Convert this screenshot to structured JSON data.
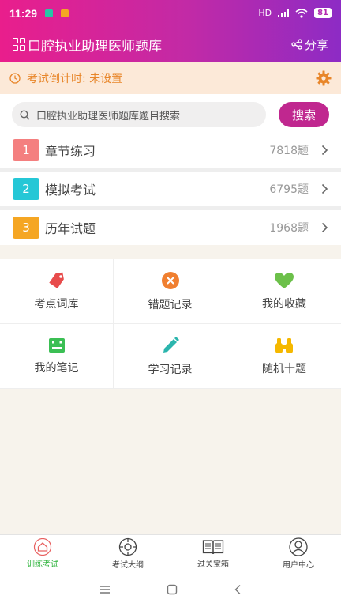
{
  "status": {
    "time": "11:29",
    "signal": "HD",
    "battery": "81"
  },
  "header": {
    "title": "口腔执业助理医师题库",
    "share_label": "分享"
  },
  "countdown": {
    "text": "考试倒计时: 未设置"
  },
  "search": {
    "placeholder": "口腔执业助理医师题库题目搜索",
    "button_label": "搜索"
  },
  "menu": [
    {
      "num": "1",
      "label": "章节练习",
      "count": "7818题",
      "color": "#f47f7f"
    },
    {
      "num": "2",
      "label": "模拟考试",
      "count": "6795题",
      "color": "#25c7d6"
    },
    {
      "num": "3",
      "label": "历年试题",
      "count": "1968题",
      "color": "#f5a623"
    }
  ],
  "tools": [
    {
      "label": "考点词库",
      "icon": "tag-icon",
      "color": "#e84c4c"
    },
    {
      "label": "错题记录",
      "icon": "close-circle-icon",
      "color": "#f07f30"
    },
    {
      "label": "我的收藏",
      "icon": "heart-icon",
      "color": "#6cc04a"
    },
    {
      "label": "我的笔记",
      "icon": "notebook-icon",
      "color": "#3bbf54"
    },
    {
      "label": "学习记录",
      "icon": "pencil-icon",
      "color": "#2bb5ad"
    },
    {
      "label": "随机十题",
      "icon": "binoculars-icon",
      "color": "#f5b800"
    }
  ],
  "tabs": [
    {
      "label": "训练考试",
      "icon": "home-icon",
      "active": true
    },
    {
      "label": "考试大纲",
      "icon": "compass-icon",
      "active": false
    },
    {
      "label": "过关宝箱",
      "icon": "book-icon",
      "active": false
    },
    {
      "label": "用户中心",
      "icon": "user-icon",
      "active": false
    }
  ],
  "colors": {
    "brand": "#c0278f",
    "active_tab": "#2db33b",
    "countdown": "#e8862a"
  }
}
